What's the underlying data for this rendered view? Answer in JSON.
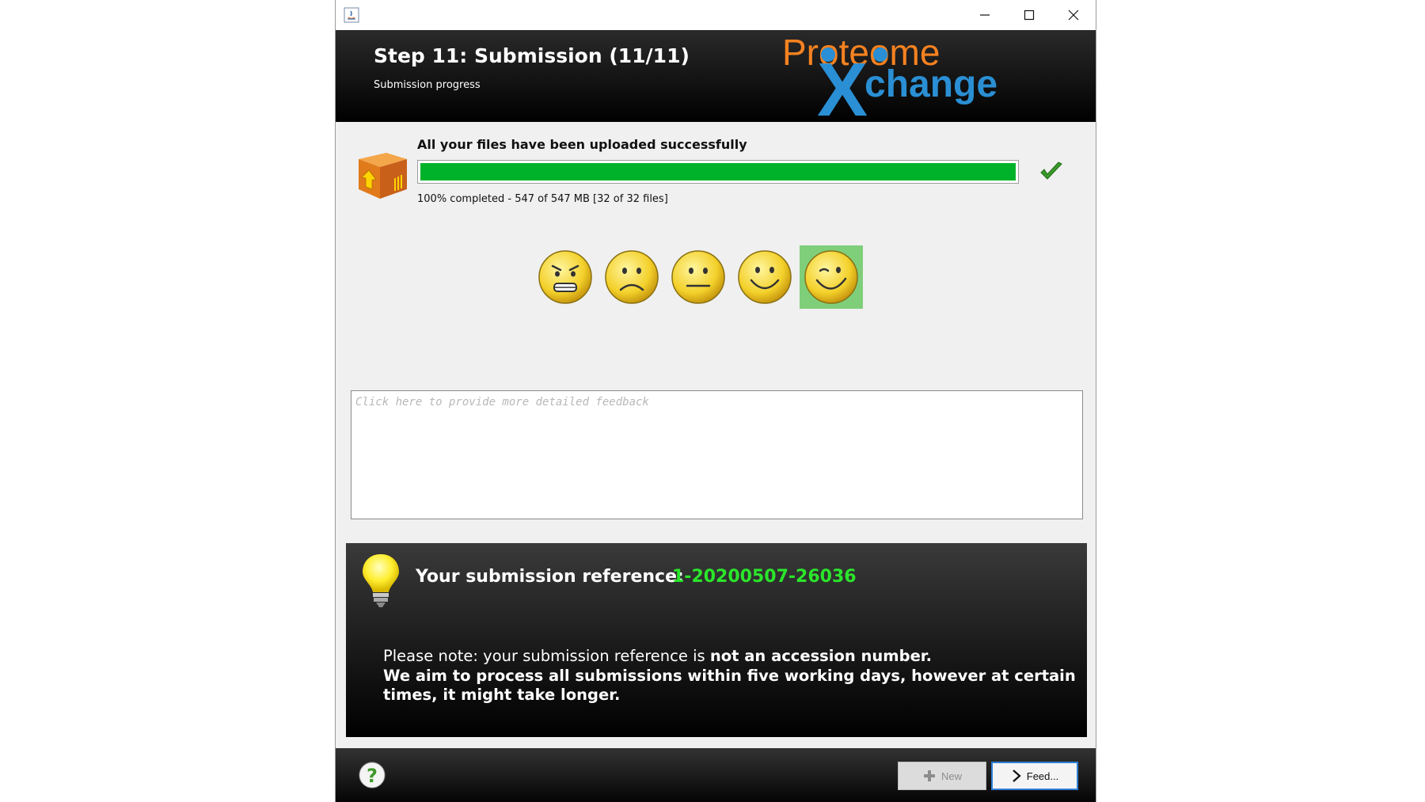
{
  "window": {
    "minimize_glyph": "—",
    "maximize_glyph": "☐",
    "close_glyph": "✕"
  },
  "header": {
    "title": "Step 11: Submission (11/11)",
    "subtitle": "Submission progress",
    "logo_text_top": "Proteome",
    "logo_text_x": "X",
    "logo_text_bottom": "change"
  },
  "upload": {
    "status": "All your files have been uploaded successfully",
    "progress_fraction": 1.0,
    "detail": "100% completed - 547 of 547 MB [32 of 32 files]",
    "bar_color": "#00b22a"
  },
  "rating": {
    "options": [
      "very-unhappy",
      "unhappy",
      "neutral",
      "happy",
      "very-happy"
    ],
    "selected": "very-happy"
  },
  "feedback": {
    "placeholder": "Click here to provide more detailed feedback"
  },
  "reference": {
    "label": "Your submission reference:",
    "value": "1-20200507-26036",
    "note_part1": "Please note: your submission reference is ",
    "note_part1_strong": "not an accession number.",
    "note_part2": "We aim to process all submissions within five working days, however at certain times, it might take longer."
  },
  "footer": {
    "new_label": "New",
    "feed_label": "Feed..."
  },
  "colors": {
    "accent_green": "#2be52b",
    "logo_orange": "#f58220",
    "logo_blue": "#2a8fd4",
    "selection_green": "#7fce7a"
  }
}
